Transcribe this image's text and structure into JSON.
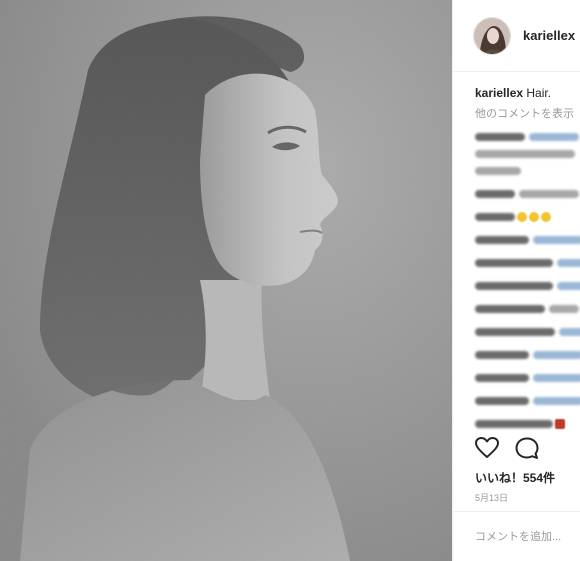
{
  "post": {
    "username": "kariellex",
    "caption_user": "kariellex",
    "caption_text": "Hair.",
    "more_comments": "他のコメントを表示",
    "likes_text": "いいね！554件",
    "date": "5月13日",
    "comment_placeholder": "コメントを追加..."
  },
  "icons": {
    "like": "heart-icon",
    "comment": "comment-icon"
  },
  "colors": {
    "text": "#262626",
    "muted": "#999999",
    "divider": "#efefef"
  }
}
